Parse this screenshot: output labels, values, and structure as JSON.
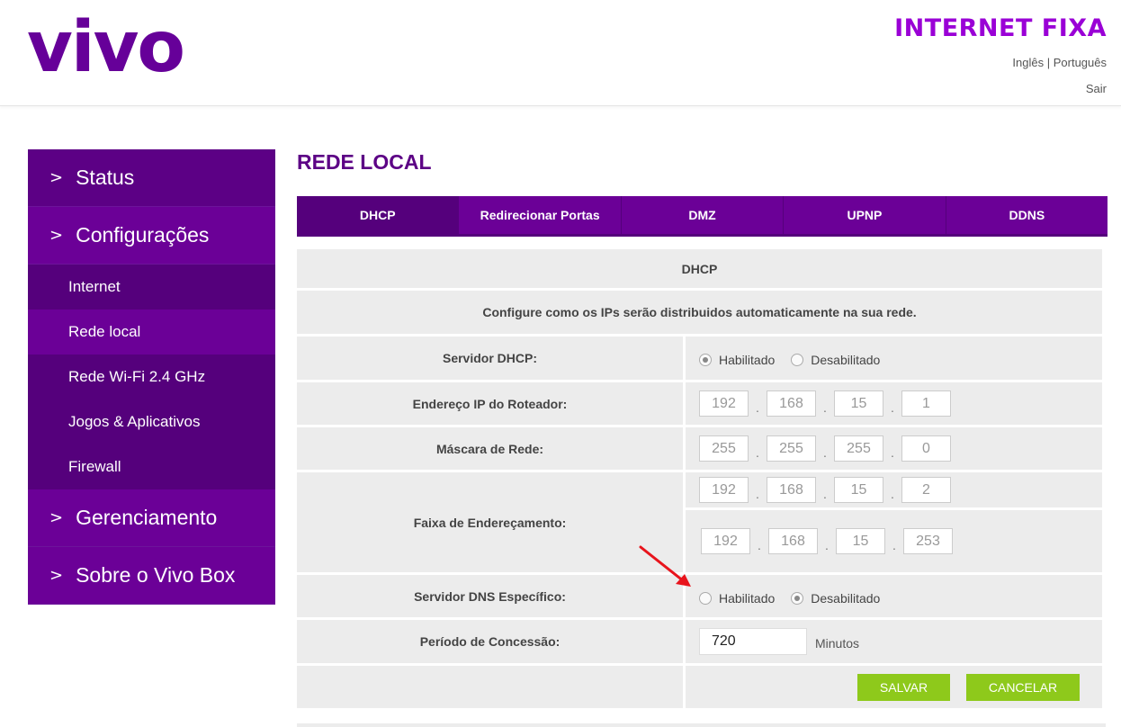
{
  "header": {
    "logo_text": "vivo",
    "title": "INTERNET FIXA",
    "lang_english": "Inglês",
    "lang_separator": " | ",
    "lang_portuguese": "Português",
    "logout": "Sair"
  },
  "sidebar": {
    "status": "Status",
    "configuracoes": "Configurações",
    "sub_items": [
      "Internet",
      "Rede local",
      "Rede Wi-Fi 2.4 GHz",
      "Jogos & Aplicativos",
      "Firewall"
    ],
    "gerenciamento": "Gerenciamento",
    "sobre": "Sobre o Vivo Box",
    "chevron": ">"
  },
  "page": {
    "title": "REDE LOCAL"
  },
  "tabs": [
    "DHCP",
    "Redirecionar Portas",
    "DMZ",
    "UPNP",
    "DDNS"
  ],
  "panel": {
    "section_title": "DHCP",
    "description": "Configure como os IPs serão distribuidos automaticamente na sua rede.",
    "dhcp_server": {
      "label": "Servidor DHCP:",
      "opt_on": "Habilitado",
      "opt_off": "Desabilitado",
      "selected": "Habilitado"
    },
    "router_ip": {
      "label": "Endereço IP do Roteador:",
      "octets": [
        "192",
        "168",
        "15",
        "1"
      ]
    },
    "mask": {
      "label": "Máscara de Rede:",
      "octets": [
        "255",
        "255",
        "255",
        "0"
      ]
    },
    "range": {
      "label": "Faixa de Endereçamento:",
      "start": [
        "192",
        "168",
        "15",
        "2"
      ],
      "end": [
        "192",
        "168",
        "15",
        "253"
      ]
    },
    "dns": {
      "label": "Servidor DNS Específico:",
      "opt_on": "Habilitado",
      "opt_off": "Desabilitado",
      "selected": "Desabilitado"
    },
    "lease": {
      "label": "Período de Concessão:",
      "value": "720",
      "unit": "Minutos"
    },
    "dot": ".",
    "save": "SALVAR",
    "cancel": "CANCELAR"
  },
  "colors": {
    "primary": "#660099",
    "tab": "#6b0097",
    "button": "#8ec91b",
    "arrow": "#e8141c"
  }
}
